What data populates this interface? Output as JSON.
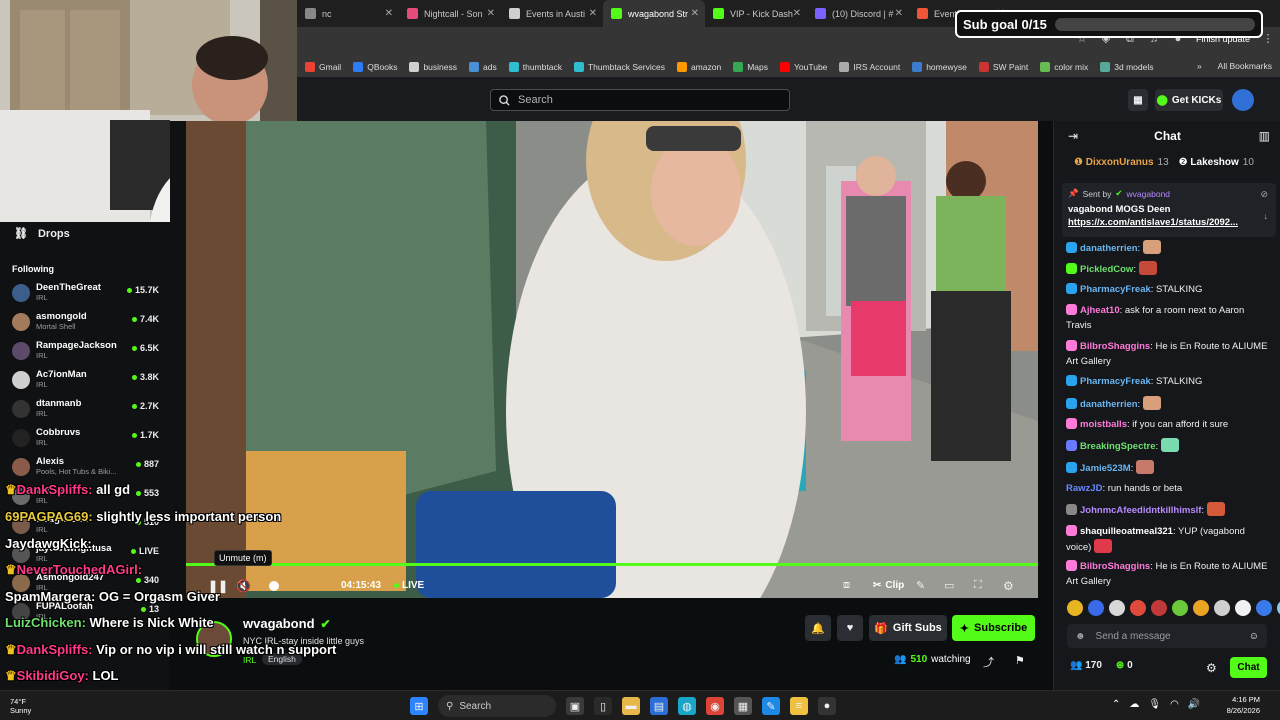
{
  "browser": {
    "tabs": [
      {
        "label": "nc",
        "fav_color": "#888",
        "active": false
      },
      {
        "label": "Nightcall - Son",
        "fav_color": "#e64b7a",
        "active": false
      },
      {
        "label": "Events in Austi",
        "fav_color": "#cfcfcf",
        "active": false
      },
      {
        "label": "wvagabond Str",
        "fav_color": "#53fc18",
        "active": true
      },
      {
        "label": "VIP - Kick Dash",
        "fav_color": "#53fc18",
        "active": false
      },
      {
        "label": "(10) Discord | #",
        "fav_color": "#7b61ff",
        "active": false
      },
      {
        "label": "Eventbrite - My",
        "fav_color": "#f05537",
        "active": false
      }
    ],
    "finish_update": "Finish update",
    "bookmarks": [
      {
        "label": "Gmail",
        "color": "#ea4335"
      },
      {
        "label": "QBooks",
        "color": "#2d7cf6"
      },
      {
        "label": "business",
        "color": "#cfcfcf"
      },
      {
        "label": "ads",
        "color": "#4a90d9"
      },
      {
        "label": "thumbtack",
        "color": "#2fbdd0"
      },
      {
        "label": "Thumbtack Services",
        "color": "#2fbdd0"
      },
      {
        "label": "amazon",
        "color": "#ff9900"
      },
      {
        "label": "Maps",
        "color": "#34a853"
      },
      {
        "label": "YouTube",
        "color": "#ff0000"
      },
      {
        "label": "IRS Account",
        "color": "#aaaaaa"
      },
      {
        "label": "homewyse",
        "color": "#3b7ccf"
      },
      {
        "label": "SW Paint",
        "color": "#c33"
      },
      {
        "label": "color mix",
        "color": "#6b5"
      },
      {
        "label": "3d models",
        "color": "#5a9"
      }
    ],
    "more_bookmarks": "»",
    "all_bookmarks": "All Bookmarks"
  },
  "site": {
    "search_placeholder": "Search",
    "get_kicks": "Get KICKs"
  },
  "sidebar": {
    "drops": "Drops",
    "following": "Following",
    "items": [
      {
        "name": "DeenTheGreat",
        "category": "IRL",
        "viewers": "15.7K",
        "color": "#3b5f8a"
      },
      {
        "name": "asmongold",
        "category": "Mortal Shell",
        "viewers": "7.4K",
        "color": "#a47a5c"
      },
      {
        "name": "RampageJackson",
        "category": "IRL",
        "viewers": "6.5K",
        "color": "#5b4a6a"
      },
      {
        "name": "Ac7ionMan",
        "category": "IRL",
        "viewers": "3.8K",
        "color": "#cfcfcf"
      },
      {
        "name": "dtanmanb",
        "category": "IRL",
        "viewers": "2.7K",
        "color": "#333"
      },
      {
        "name": "Cobbruvs",
        "category": "IRL",
        "viewers": "1.7K",
        "color": "#222"
      },
      {
        "name": "Alexis",
        "category": "Pools, Hot Tubs & Biki...",
        "viewers": "887",
        "color": "#8a5a4a"
      },
      {
        "name": "salyscott",
        "category": "IRL",
        "viewers": "553",
        "color": "#6a6a6a"
      },
      {
        "name": "wvagabond",
        "category": "IRL",
        "viewers": "510",
        "color": "#7a5a4a"
      },
      {
        "name": "jaycartwrightusa",
        "category": "IRL",
        "viewers": "LIVE",
        "color": "#555"
      },
      {
        "name": "Asmongold247",
        "category": "IRL",
        "viewers": "340",
        "color": "#8a6a4a"
      },
      {
        "name": "FUPALoofah",
        "category": "IRL",
        "viewers": "13",
        "color": "#444"
      }
    ]
  },
  "overlay_chat": [
    {
      "user": "DankSpliffs:",
      "text": " all gd ",
      "color": "#ff3a8a",
      "crown": true
    },
    {
      "user": "69PAGPAG69:",
      "text": " slightly less important person",
      "color": "#e8c93a",
      "crown": false
    },
    {
      "user": "JaydawgKick:",
      "text": " ",
      "color": "#ffffff",
      "crown": false
    },
    {
      "user": "NeverTouchedAGirl:",
      "text": " ",
      "color": "#ff3a8a",
      "crown": true
    },
    {
      "user": "SpamMargera:",
      "text": " OG = Orgasm Giver",
      "color": "#ffffff",
      "crown": false
    },
    {
      "user": "LuizChicken:",
      "text": " Where is Nick White",
      "color": "#6ee06e",
      "crown": false
    },
    {
      "user": "DankSpliffs:",
      "text": " Vip or no vip i will still watch n support ",
      "color": "#ff3a8a",
      "crown": true
    },
    {
      "user": "SkibidiGoy:",
      "text": " LOL",
      "color": "#ff3a8a",
      "crown": true
    },
    {
      "user": "DankSpliffs:",
      "text": "",
      "color": "#ff3a8a",
      "crown": true
    }
  ],
  "sub_goal": {
    "label": "Sub goal 0/15",
    "progress": 0.0
  },
  "player": {
    "tooltip": "Unmute (m)",
    "time": "04:15:43",
    "live": "LIVE",
    "clip": "Clip",
    "progress": 1.0
  },
  "stream": {
    "streamer": "wvagabond",
    "title": "NYC IRL-stay inside little guys",
    "category": "IRL",
    "language": "English",
    "gift_subs": "Gift Subs",
    "subscribe": "Subscribe",
    "watching_count": "510",
    "watching_label": "watching"
  },
  "chat": {
    "title": "Chat",
    "top_gifters": [
      {
        "name": "DixxonUranus",
        "count": "13",
        "color": "#e8a44a"
      },
      {
        "name": "Lakeshow",
        "count": "10",
        "color": "#ffffff"
      }
    ],
    "pinned": {
      "sent_by_label": "Sent by",
      "sent_by_user": "wvagabond",
      "text": "vagabond MOGS Deen",
      "link": "https://x.com/antislave1/status/2092..."
    },
    "messages": [
      {
        "user": "danatherrien",
        "text": "",
        "color": "#6ab6f2",
        "badge": "#2aa4ef",
        "emote": "#d8a07a"
      },
      {
        "user": "PickledCow",
        "text": "",
        "color": "#6ee06e",
        "badge": "#53fc18",
        "emote": "#c64a3a"
      },
      {
        "user": "PharmacyFreak",
        "text": " STALKING",
        "color": "#6ab6f2",
        "badge": "#2aa4ef",
        "emote": ""
      },
      {
        "user": "Ajheat10",
        "text": " ask for a room next to Aaron Travis",
        "color": "#ff7ad9",
        "badge": "#ff7ad9",
        "emote": ""
      },
      {
        "user": "BilbroShaggins",
        "text": " He is En Route to ALIUME Art Gallery",
        "color": "#ff7ad9",
        "badge": "#ff7ad9",
        "emote": ""
      },
      {
        "user": "PharmacyFreak",
        "text": " STALKING",
        "color": "#6ab6f2",
        "badge": "#2aa4ef",
        "emote": ""
      },
      {
        "user": "danatherrien",
        "text": "",
        "color": "#6ab6f2",
        "badge": "#2aa4ef",
        "emote": "#d8a07a"
      },
      {
        "user": "moistballs",
        "text": " if you can afford it sure",
        "color": "#ff7ad9",
        "badge": "#ff7ad9",
        "emote": ""
      },
      {
        "user": "BreakingSpectre",
        "text": "",
        "color": "#6ee06e",
        "badge": "#6a7aff",
        "emote": "#7adbb0"
      },
      {
        "user": "Jamie523M",
        "text": "",
        "color": "#6ab6f2",
        "badge": "#2aa4ef",
        "emote": "#c87a6a"
      },
      {
        "user": "RawzJD",
        "text": " run hands or beta",
        "color": "#6a8aff",
        "badge": "",
        "emote": ""
      },
      {
        "user": "JohnmcAfeedidntkillhimslf",
        "text": "",
        "color": "#b88aff",
        "badge": "#888",
        "emote": "#d45a3a"
      },
      {
        "user": "shaquilleoatmeal321",
        "text": " YUP (vagabond voice)",
        "color": "#ffffff",
        "badge": "#ff7ad9",
        "emote": "#e03a4a"
      },
      {
        "user": "BilbroShaggins",
        "text": " He is En Route to ALIUME Art Gallery",
        "color": "#ff7ad9",
        "badge": "#ff7ad9",
        "emote": ""
      }
    ],
    "input_placeholder": "Send a message",
    "kicks": "170",
    "points": "0",
    "send": "Chat"
  },
  "taskbar": {
    "weather_temp": "74°F",
    "weather_desc": "Sunny",
    "search": "Search",
    "time": "4:16 PM",
    "date": "8/26/2026"
  }
}
